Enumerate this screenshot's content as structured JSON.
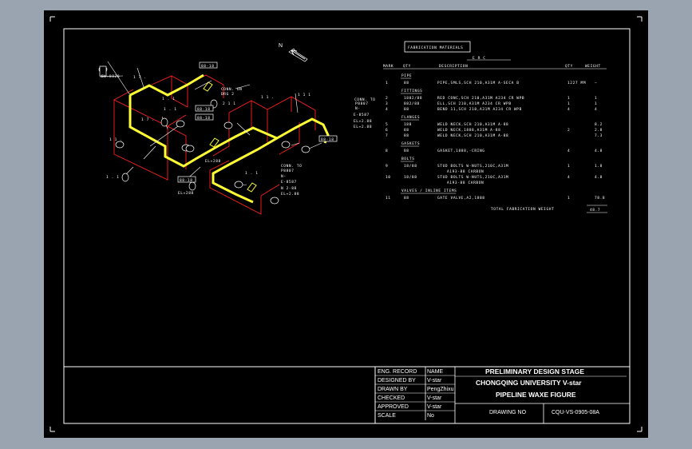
{
  "north_label": "N",
  "fabrication_materials_title": "FABRICATION MATERIALS",
  "bom": {
    "erc_label": "E R C",
    "headers": [
      "MARK",
      "QTY",
      "DESCRIPTION",
      "QTY",
      "WEIGHT"
    ],
    "sections": [
      {
        "name": "PIPE",
        "rows": [
          [
            "1",
            "88",
            "PIPE,SMLS,SCH 210,A31M A-SECA B",
            "1227 MM",
            "—"
          ]
        ]
      },
      {
        "name": "FITTINGS",
        "rows": [
          [
            "2",
            "1882/88",
            "RED CONC,SCH 210,A31M A234 CR WPB",
            "1",
            "1"
          ],
          [
            "3",
            "882/88",
            "ELL,SCH 210,A31M A234 CR WPB",
            "1",
            "1"
          ],
          [
            "4",
            "88",
            "BEND 11,SCH 210,A31M A234 CR WPB",
            "4",
            "4"
          ]
        ]
      },
      {
        "name": "FLANGES",
        "rows": [
          [
            "5",
            "188",
            "WELD NECK,SCH 210,A31M A-88",
            "",
            "8.2"
          ],
          [
            "6",
            "88",
            "WELD NECK,1888,A31M A-88",
            "2",
            "2.8"
          ],
          [
            "7",
            "88",
            "WELD NECK,SCH 210,A31M A-88",
            "",
            "7.3"
          ]
        ]
      },
      {
        "name": "GASKETS",
        "rows": [
          [
            "8",
            "88",
            "GASKET,1888,-CRING",
            "4",
            "4.8"
          ]
        ]
      },
      {
        "name": "BOLTS",
        "rows": [
          [
            "9",
            "18/88",
            "STUD BOLTS W-NUTS,210C,A31M",
            "1",
            "1.8",
            "A193-88 CARBON"
          ],
          [
            "10",
            "18/88",
            "STUD BOLTS W-NUTS,210C,A31M",
            "4",
            "4.8",
            "A193-88 CARBON"
          ]
        ]
      },
      {
        "name": "VALVES / INLINE ITEMS",
        "rows": [
          [
            "11",
            "88",
            "GATE VALVE,A2,1888",
            "1",
            "78.8"
          ]
        ]
      }
    ],
    "total_label": "TOTAL FABRICATION WEIGHT",
    "total_value": "48.7"
  },
  "iso_labels": {
    "conn_top": "CONN. ON",
    "conn_top2": "DRG 2",
    "conn_left": "CONN. TO",
    "conn_left_lines": [
      "P8807",
      "N-",
      "E-8587",
      "EL+2.88",
      "EL+2.88"
    ],
    "conn_bottom": "CONN. TO",
    "conn_bottom_lines": [
      "P8807",
      "N-",
      "E-8587",
      "N 2-88",
      "EL+2.88"
    ],
    "coord_top": "EL+8828",
    "coord_mid": "EL+288",
    "coord_left": "EL+288",
    "tag_boxes": [
      "88-18",
      "88-18",
      "88-18",
      "88-18",
      "88-18",
      "88-18"
    ]
  },
  "title_block": {
    "rows": [
      {
        "label": "ENG. RECORD",
        "value": "NAME"
      },
      {
        "label": "DESIGNED  BY",
        "value": "V-star"
      },
      {
        "label": "DRAWN  BY",
        "value": "PengZhixu"
      },
      {
        "label": "CHECKED",
        "value": "V-star"
      },
      {
        "label": "APPROVED",
        "value": "V-star"
      },
      {
        "label": "SCALE",
        "value": "No"
      }
    ],
    "stage": "PRELIMINARY DESIGN STAGE",
    "university": "CHONGQING UNIVERSITY V-star",
    "figure_title": "PIPELINE WAXE FIGURE",
    "drawing_no_label": "DRAWING NO",
    "drawing_no": "CQU-VS-0905-08A"
  },
  "colors": {
    "pipe": "#ffff33",
    "frame": "#ff2020",
    "background": "#000000",
    "line": "#ffffff"
  }
}
